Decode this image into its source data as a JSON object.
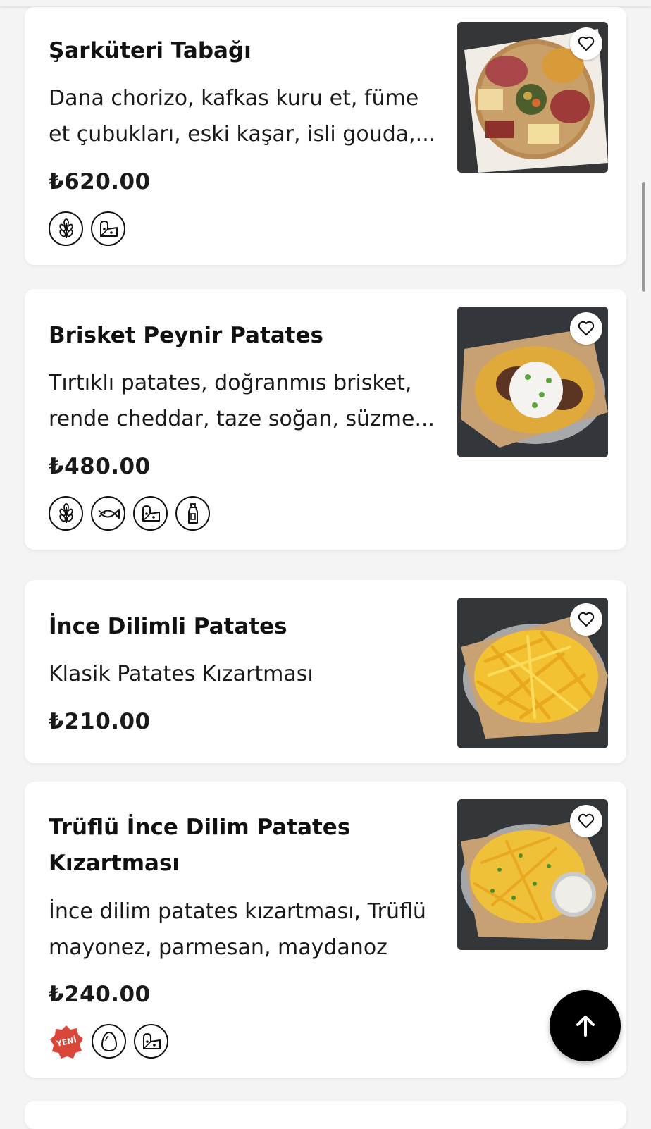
{
  "items": [
    {
      "title": "Şarküteri Tabağı",
      "description": "Dana chorizo, kafkas kuru et, füme et çubukları, eski kaşar, isli gouda,...",
      "price": "₺620.00",
      "image": "charcuterie-board-photo",
      "allergens": [
        "wheat-icon",
        "cheese-icon"
      ]
    },
    {
      "title": "Brisket Peynir Patates",
      "description": "Tırtıklı patates, doğranmıs brisket, rende cheddar, taze soğan, süzme...",
      "price": "₺480.00",
      "image": "brisket-cheese-fries-photo",
      "allergens": [
        "wheat-icon",
        "fish-icon",
        "cheese-icon",
        "sauce-bottle-icon"
      ]
    },
    {
      "title": "İnce Dilimli Patates",
      "description": "Klasik Patates Kızartması",
      "price": "₺210.00",
      "image": "thin-fries-photo",
      "allergens": []
    },
    {
      "title": "Trüflü İnce Dilim Patates Kızartması",
      "description": "İnce dilim patates kızartması, Trüflü mayonez, parmesan, maydanoz",
      "price": "₺240.00",
      "image": "truffle-fries-photo",
      "badge": "YENİ",
      "allergens": [
        "egg-icon",
        "cheese-icon"
      ]
    }
  ],
  "colors": {
    "badge": "#d9473b",
    "scroll_button": "#000000"
  },
  "scroll_top_icon": "arrow-up-icon",
  "favorite_icon": "heart-outline-icon"
}
